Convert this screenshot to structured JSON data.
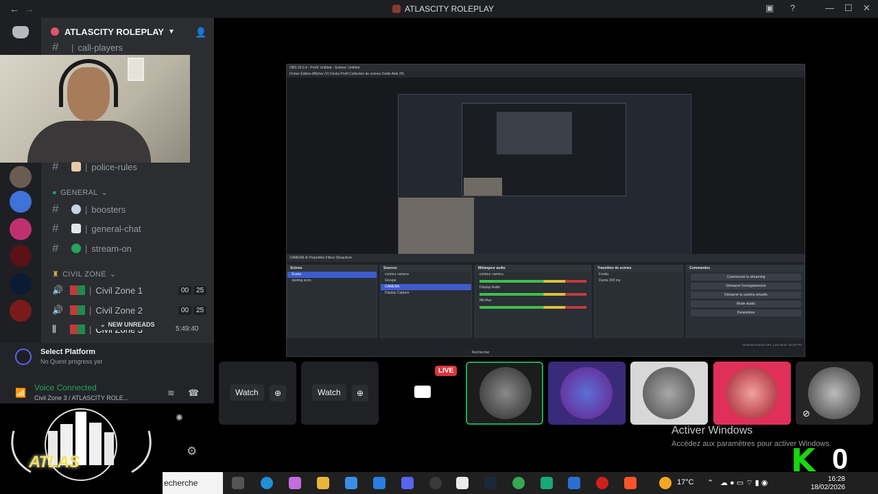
{
  "window": {
    "title": "ATLASCITY ROLEPLAY"
  },
  "server": {
    "name": "ATLASCITY ROLEPLAY"
  },
  "channels": {
    "top_partial": "call-players",
    "police_rules": "police-rules",
    "category_general": "GENERAL",
    "boosters": "boosters",
    "general_chat": "general-chat",
    "stream_on": "stream-on",
    "category_civil": "CIVIL ZONE",
    "voice": [
      {
        "label": "Civil Zone 1",
        "count_a": "00",
        "count_b": "25"
      },
      {
        "label": "Civil Zone 2",
        "count_a": "00",
        "count_b": "25"
      },
      {
        "label": "Civil Zone 3"
      }
    ],
    "new_unreads": "NEW UNREADS",
    "timer": "5:49:40"
  },
  "platform": {
    "title": "Select Platform",
    "subtitle": "No Quest progress yet"
  },
  "voice_status": {
    "title": "Voice Connected",
    "subtitle": "Civil Zone 3 / ATLASCITY ROLE..."
  },
  "obs": {
    "title": "OBS 32.0.4 - Profil: Untitled - Scènes: Untitled",
    "menu": "Fichier   Édition   Afficher (V)   Docks   Profil   Collection de scènes   Outils   Aide (H)",
    "source_bar": "CAMERA          ⚙ Propriétés     Filtres     Désactiver",
    "docks": {
      "scenes_h": "Scènes",
      "scenes": [
        "Scene",
        "starting soon"
      ],
      "sources_h": "Sources",
      "sources": [
        "contour camera",
        "Groupe",
        "CAMERA",
        "Display Capture"
      ],
      "mixer_h": "Mélangeur audio",
      "mixer": [
        "contour camera",
        "Display Audio",
        "Mic/Aux"
      ],
      "trans_h": "Transition de scènes",
      "trans": [
        "Fondu",
        "Durée   300 ms"
      ],
      "ctrl_h": "Commandes",
      "ctrl": [
        "Commencer le streaming",
        "Démarrer l'enregistrement",
        "Démarrer la caméra virtuelle",
        "Mode studio",
        "Paramètres"
      ]
    },
    "status": "00:00:00   00:00:00   CPU: 1.6%   30.00 / 30.00 FPS",
    "task": "Rechercher"
  },
  "tiles": {
    "watch": "Watch",
    "live": "LIVE"
  },
  "windows": {
    "activate": "Activer Windows",
    "activate_sub": "Accédez aux paramètres pour activer Windows."
  },
  "overlay": {
    "k": "K",
    "zero": "0"
  },
  "taskbar": {
    "search": "echerche",
    "weather": "17°C",
    "time": "16:28",
    "date": "18/02/2026"
  },
  "colors": {
    "accent": "#5865f2",
    "live": "#da373c",
    "connected": "#23a55a",
    "k": "#17d70f"
  }
}
